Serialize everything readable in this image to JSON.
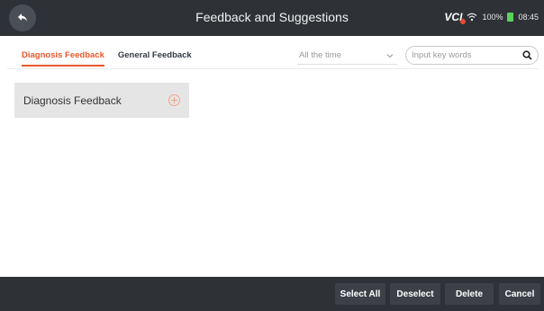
{
  "header": {
    "title": "Feedback and Suggestions",
    "back_icon": "back-arrow-icon",
    "status": {
      "vci_label": "VCI",
      "wifi_icon": "wifi-icon",
      "battery_percent": "100%",
      "battery_icon": "battery-icon",
      "time": "08:45"
    }
  },
  "tabs": [
    {
      "label": "Diagnosis Feedback",
      "active": true
    },
    {
      "label": "General Feedback",
      "active": false
    }
  ],
  "filter": {
    "time_selected": "All the time",
    "dropdown_icon": "chevron-down-icon"
  },
  "search": {
    "placeholder": "Input key words",
    "value": "",
    "icon": "search-icon"
  },
  "card": {
    "label": "Diagnosis Feedback",
    "icon": "add-circle-icon"
  },
  "footer": {
    "select_all": "Select All",
    "deselect": "Deselect",
    "delete": "Delete",
    "cancel": "Cancel"
  },
  "colors": {
    "accent": "#e9572c",
    "bar": "#2e3136",
    "button": "#3d4147",
    "card": "#e5e5e5"
  }
}
